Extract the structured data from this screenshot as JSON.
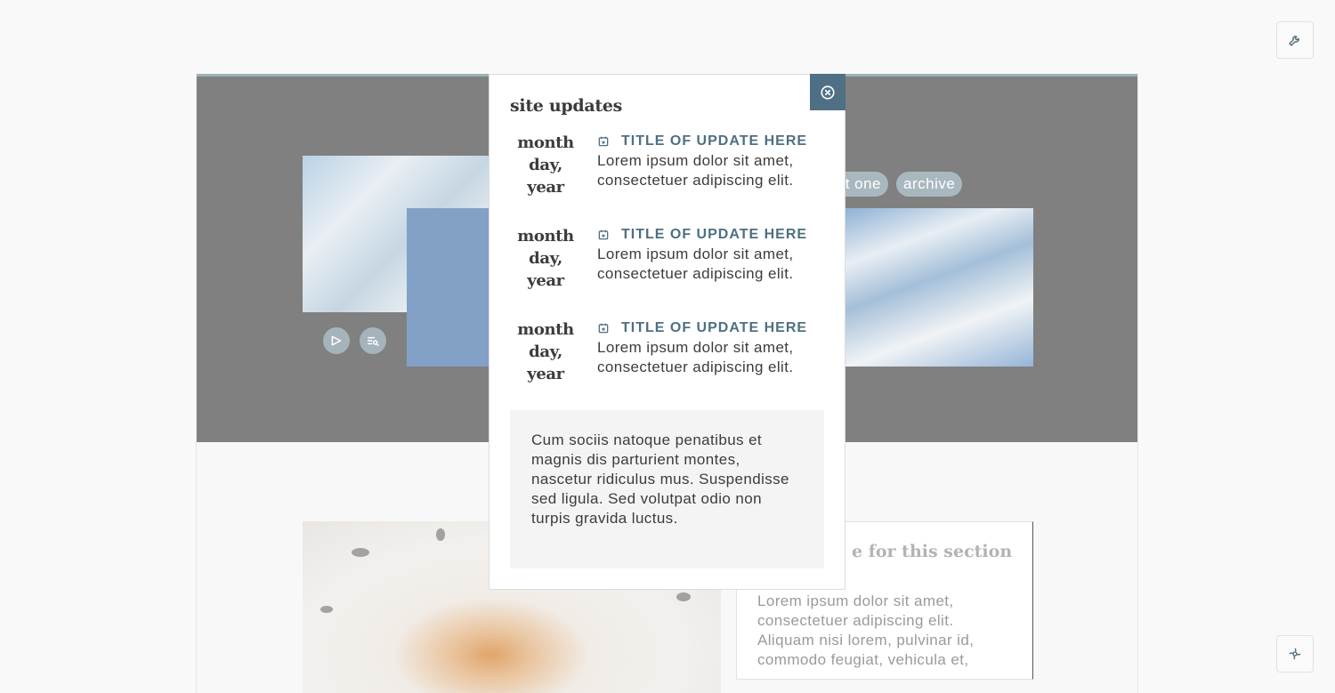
{
  "modal": {
    "title": "site updates",
    "close_icon": "close-circle-icon",
    "updates": [
      {
        "date": "month day, year",
        "icon": "calendar-star-icon",
        "title": "TITLE OF UPDATE HERE",
        "text": "Lorem ipsum dolor sit amet, consectetuer adipiscing elit."
      },
      {
        "date": "month day, year",
        "icon": "calendar-star-icon",
        "title": "TITLE OF UPDATE HERE",
        "text": "Lorem ipsum dolor sit amet, consectetuer adipiscing elit."
      },
      {
        "date": "month day, year",
        "icon": "calendar-star-icon",
        "title": "TITLE OF UPDATE HERE",
        "text": "Lorem ipsum dolor sit amet, consectetuer adipiscing elit."
      }
    ],
    "note": "Cum sociis natoque penatibus et magnis dis parturient montes, nascetur ridiculus mus. Suspendisse sed ligula. Sed volutpat odio non turpis gravida luctus."
  },
  "header": {
    "pills": [
      "t one",
      "archive"
    ]
  },
  "section": {
    "title": "e for this section",
    "text": "Lorem ipsum dolor sit amet, consectetuer adipiscing elit. Aliquam nisi lorem, pulvinar id, commodo feugiat, vehicula et,"
  },
  "controls": {
    "settings_icon": "wrench-icon",
    "theme_icon": "palette-icon",
    "play_icon": "play-icon",
    "search_list_icon": "list-search-icon"
  },
  "colors": {
    "accent": "#4e6f84",
    "header_bg": "#808080",
    "pill_bg": "#a9b8be"
  }
}
